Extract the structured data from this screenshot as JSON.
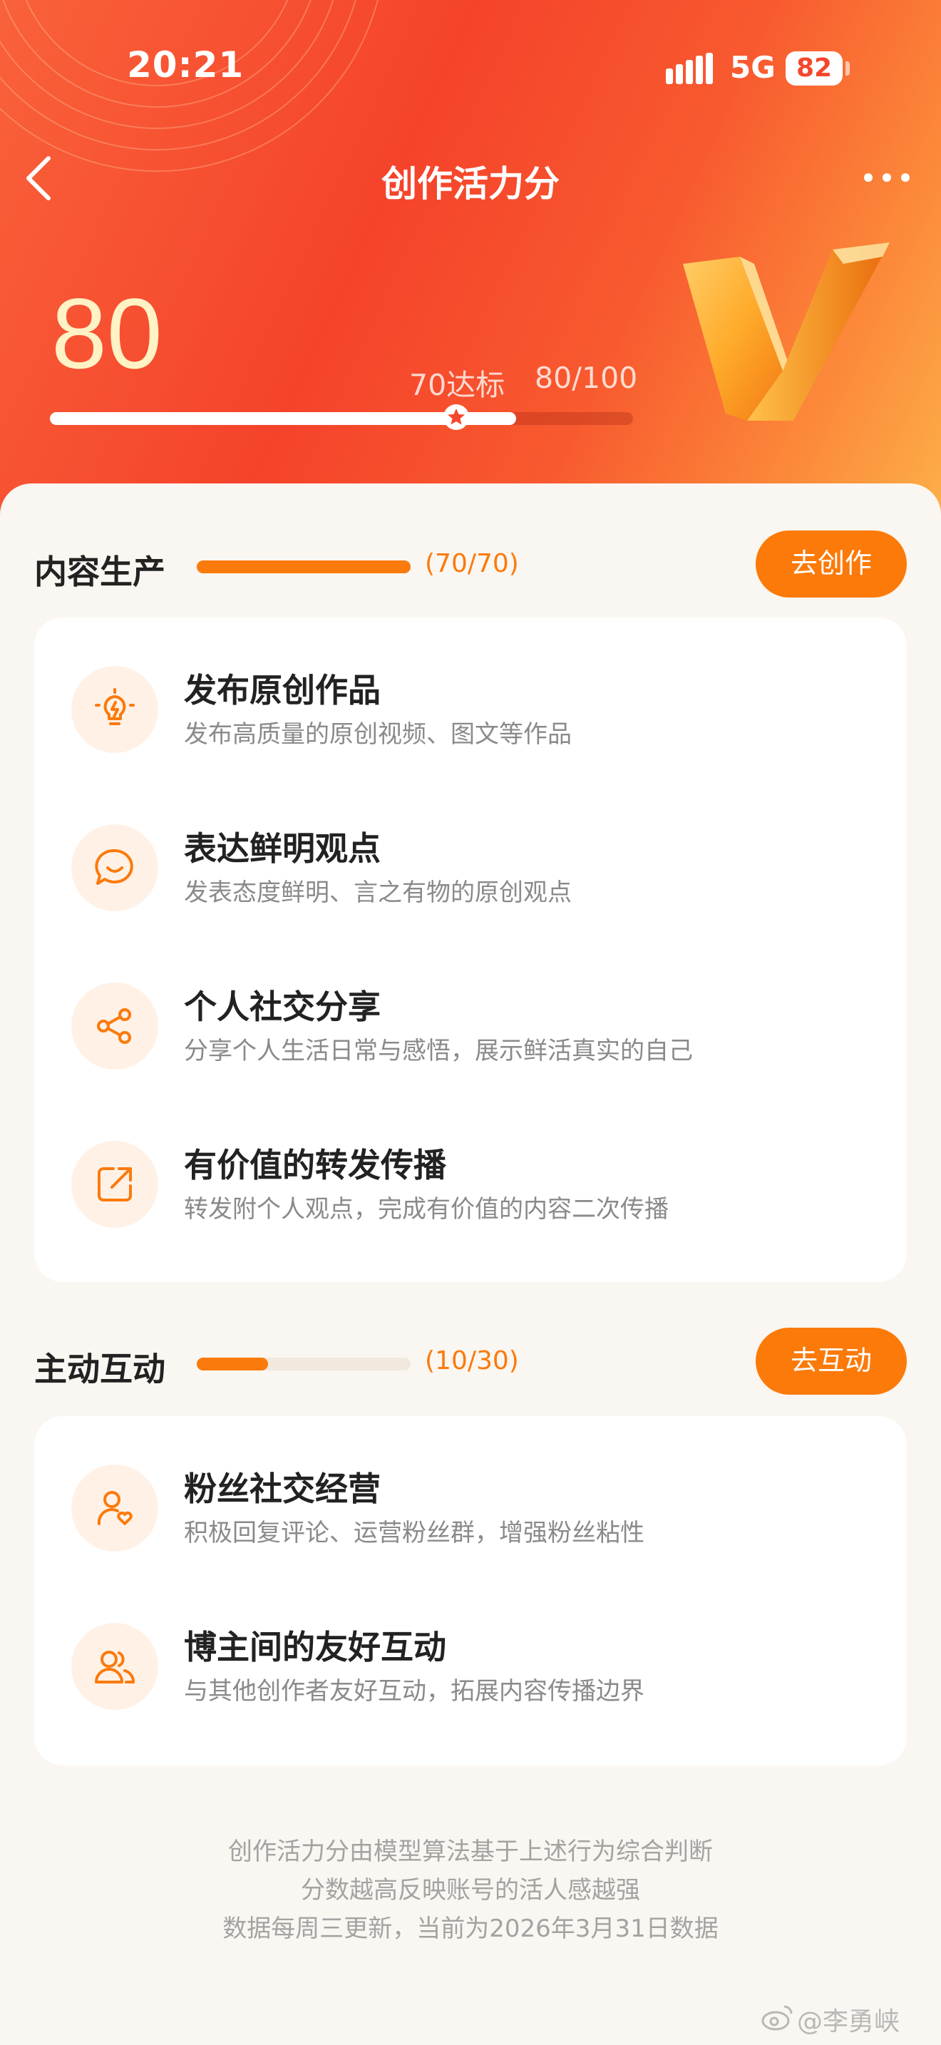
{
  "status_bar": {
    "time": "20:21",
    "network": "5G",
    "battery": "82"
  },
  "nav": {
    "title": "创作活力分"
  },
  "score": {
    "value": "80",
    "standard_label": "70达标",
    "ratio": "80/100",
    "progress": 0.8
  },
  "sections": [
    {
      "title": "内容生产",
      "count": "(70/70)",
      "progress": 1.0,
      "button_label": "去创作",
      "items": [
        {
          "title": "发布原创作品",
          "desc": "发布高质量的原创视频、图文等作品",
          "icon": "lightbulb-icon"
        },
        {
          "title": "表达鲜明观点",
          "desc": "发表态度鲜明、言之有物的原创观点",
          "icon": "speech-bubble-icon"
        },
        {
          "title": "个人社交分享",
          "desc": "分享个人生活日常与感悟，展示鲜活真实的自己",
          "icon": "share-icon"
        },
        {
          "title": "有价值的转发传播",
          "desc": "转发附个人观点，完成有价值的内容二次传播",
          "icon": "forward-icon"
        }
      ]
    },
    {
      "title": "主动互动",
      "count": "(10/30)",
      "progress": 0.333,
      "button_label": "去互动",
      "items": [
        {
          "title": "粉丝社交经营",
          "desc": "积极回复评论、运营粉丝群，增强粉丝粘性",
          "icon": "user-heart-icon"
        },
        {
          "title": "博主间的友好互动",
          "desc": "与其他创作者友好互动，拓展内容传播边界",
          "icon": "users-icon"
        }
      ]
    }
  ],
  "footer": {
    "lines": [
      "创作活力分由模型算法基于上述行为综合判断",
      "分数越高反映账号的活人感越强",
      "数据每周三更新，当前为2026年3月31日数据"
    ]
  },
  "watermark": "@李勇峡",
  "colors": {
    "accent": "#fc7a09",
    "hero_red": "#f5432b",
    "hero_orange": "#fdb14a"
  }
}
